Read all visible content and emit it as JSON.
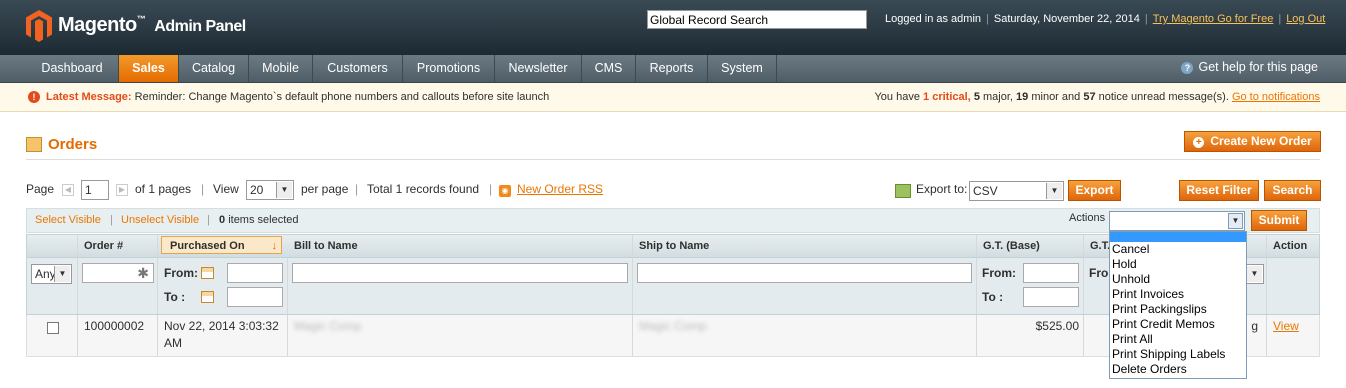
{
  "header": {
    "brand": "Magento",
    "brand_suffix": "Admin Panel",
    "search_value": "Global Record Search",
    "logged_in": "Logged in as admin",
    "date": "Saturday, November 22, 2014",
    "try_link": "Try Magento Go for Free",
    "logout": "Log Out"
  },
  "nav": {
    "items": [
      "Dashboard",
      "Sales",
      "Catalog",
      "Mobile",
      "Customers",
      "Promotions",
      "Newsletter",
      "CMS",
      "Reports",
      "System"
    ],
    "active": "Sales",
    "help": "Get help for this page"
  },
  "message": {
    "label": "Latest Message:",
    "text": "Reminder: Change Magento`s default phone numbers and callouts before site launch",
    "summary_prefix": "You have",
    "critical_count": "1",
    "critical_label": "critical,",
    "major_count": "5",
    "major_label": "major,",
    "minor_count": "19",
    "minor_label": "minor and",
    "notice_count": "57",
    "notice_label": "notice unread message(s).",
    "link": "Go to notifications"
  },
  "page": {
    "title": "Orders",
    "create_button": "Create New Order"
  },
  "pager": {
    "page_label": "Page",
    "page_value": "1",
    "of_pages": "of 1 pages",
    "view_label": "View",
    "per_page_value": "20",
    "per_page_label": "per page",
    "records": "Total 1 records found",
    "rss": "New Order RSS",
    "export_label": "Export to:",
    "export_value": "CSV",
    "export_button": "Export",
    "reset_button": "Reset Filter",
    "search_button": "Search"
  },
  "massaction": {
    "select_visible": "Select Visible",
    "unselect_visible": "Unselect Visible",
    "selected_count": "0",
    "selected_label": "items selected",
    "actions_label": "Actions",
    "submit": "Submit",
    "options": [
      "",
      "Cancel",
      "Hold",
      "Unhold",
      "Print Invoices",
      "Print Packingslips",
      "Print Credit Memos",
      "Print All",
      "Print Shipping Labels",
      "Delete Orders"
    ]
  },
  "grid": {
    "columns": [
      "Order #",
      "Purchased On",
      "Bill to Name",
      "Ship to Name",
      "G.T. (Base)",
      "G.T.",
      "Action"
    ],
    "filters": {
      "any": "Any",
      "from": "From:",
      "to": "To :"
    },
    "rows": [
      {
        "order": "100000002",
        "purchased_line1": "Nov 22, 2014 3:03:32",
        "purchased_line2": "AM",
        "bill_to": "Magic Comp",
        "ship_to": "Magic Comp",
        "gt_base": "$525.00",
        "gt_partial": "g",
        "action": "View"
      }
    ]
  }
}
